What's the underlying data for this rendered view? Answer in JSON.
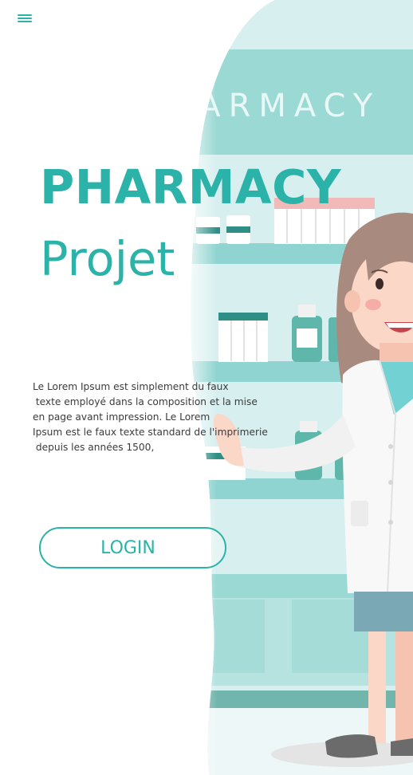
{
  "header": {
    "menu_icon": "hamburger-menu-icon"
  },
  "hero": {
    "title": "PHARMACY",
    "subtitle": "Projet",
    "illustration_sign_text": "PHARMACY",
    "description_lines": [
      "Le Lorem Ipsum est simplement du faux",
      " texte employé dans la composition et la mise",
      "en page avant impression. Le Lorem",
      "Ipsum est le faux texte standard de l'imprimerie",
      " depuis les années 1500,"
    ],
    "login_label": "LOGIN"
  },
  "colors": {
    "accent": "#2bb3a9",
    "shelf_bg": "#d5eeee",
    "shelf_teal": "#8fd4d0",
    "text": "#3b3b3b"
  }
}
